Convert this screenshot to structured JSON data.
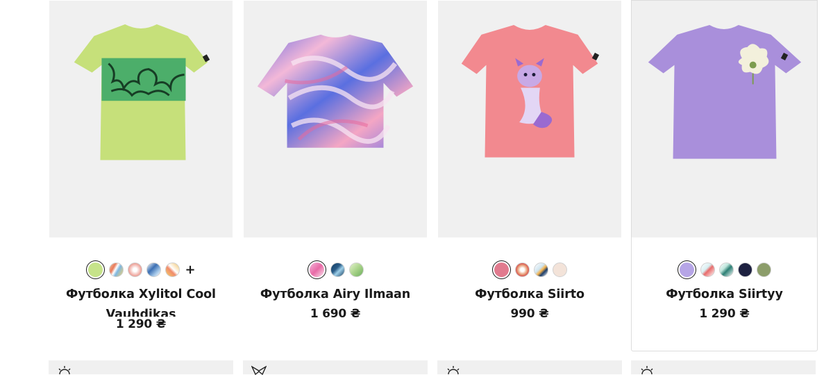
{
  "products": [
    {
      "name": "Футболка Xylitol Cool Vauhdikas",
      "price": "1 290 ₴",
      "swatches": [
        "#c6e38a",
        "multi-stripes",
        "#f0b0a8",
        "#3b6fb3",
        "#f2c36a"
      ],
      "more_label": "+",
      "shirt_color": "#c6e07a"
    },
    {
      "name": "Футболка Airy Ilmaan",
      "price": "1 690 ₴",
      "swatches": [
        "#e8a6d8",
        "#2b5d88",
        "#a9d38a"
      ],
      "shirt_color": "#9b87e4"
    },
    {
      "name": "Футболка Siirto",
      "price": "990 ₴",
      "swatches": [
        "#e17a8e",
        "#e8a07a",
        "#cfe4ef",
        "#f3e3d9"
      ],
      "shirt_color": "#f2898f"
    },
    {
      "name": "Футболка Siirtyy",
      "price": "1 290 ₴",
      "swatches": [
        "#b6a5e6",
        "#d9eef1",
        "#bfe6dc",
        "#1d2140",
        "#8c9d6a"
      ],
      "shirt_color": "#a98fdb"
    }
  ],
  "next_row_icons": [
    "sun-icon",
    "bird-icon",
    "sun-icon",
    "sun-icon"
  ]
}
